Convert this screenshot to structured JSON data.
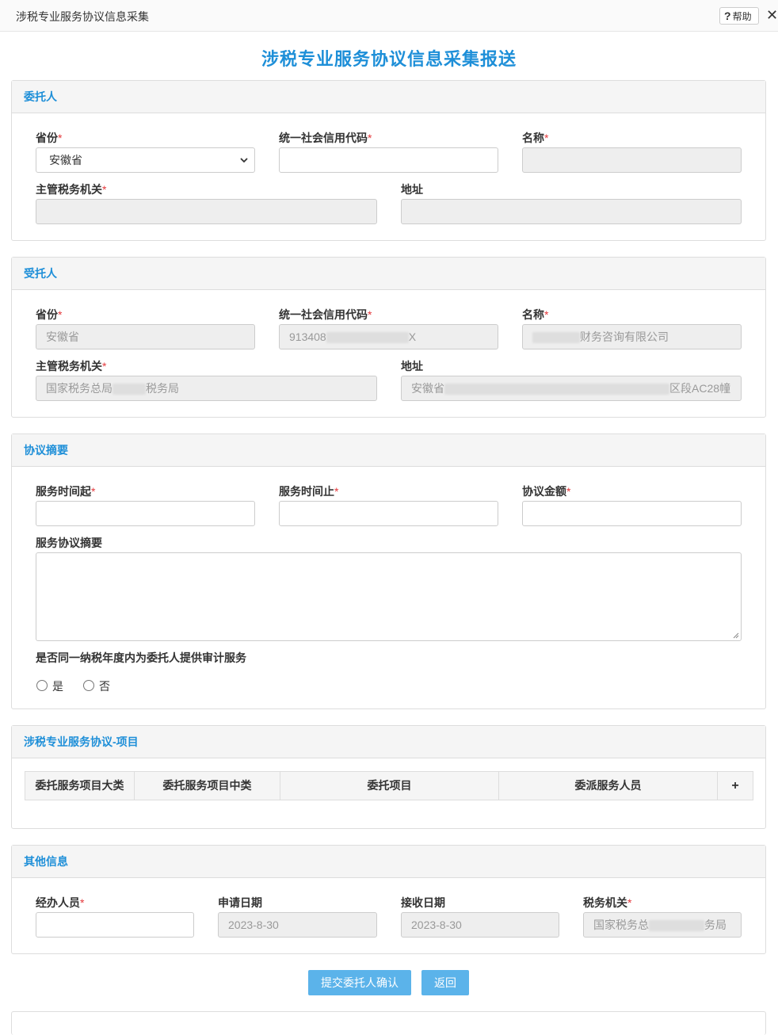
{
  "window": {
    "title": "涉税专业服务协议信息采集",
    "help_label": "帮助",
    "help_glyph": "?",
    "close_glyph": "✕"
  },
  "page": {
    "title": "涉税专业服务协议信息采集报送"
  },
  "colors": {
    "accent": "#1e8fd8",
    "button": "#5bb3ea",
    "required": "#e4393c"
  },
  "required_mark": "*",
  "principal": {
    "heading": "委托人",
    "province_label": "省份",
    "province_value": "安徽省",
    "credit_code_label": "统一社会信用代码",
    "credit_code_value": "",
    "name_label": "名称",
    "name_value": "",
    "tax_authority_label": "主管税务机关",
    "tax_authority_value": "",
    "address_label": "地址",
    "address_value": ""
  },
  "agent": {
    "heading": "受托人",
    "province_label": "省份",
    "province_value": "安徽省",
    "credit_code_label": "统一社会信用代码",
    "credit_code_prefix": "913408",
    "credit_code_suffix": "X",
    "name_label": "名称",
    "name_suffix": "财务咨询有限公司",
    "tax_authority_label": "主管税务机关",
    "tax_authority_prefix": "国家税务总局",
    "tax_authority_suffix": "税务局",
    "address_label": "地址",
    "address_prefix": "安徽省",
    "address_suffix": "区段AC28幢"
  },
  "summary": {
    "heading": "协议摘要",
    "start_label": "服务时间起",
    "end_label": "服务时间止",
    "amount_label": "协议金额",
    "desc_label": "服务协议摘要",
    "audit_question": "是否同一纳税年度内为委托人提供审计服务",
    "yes_label": "是",
    "no_label": "否"
  },
  "items": {
    "heading": "涉税专业服务协议-项目",
    "columns": [
      "委托服务项目大类",
      "委托服务项目中类",
      "委托项目",
      "委派服务人员"
    ],
    "add_glyph": "+"
  },
  "other": {
    "heading": "其他信息",
    "handler_label": "经办人员",
    "apply_date_label": "申请日期",
    "apply_date_value": "2023-8-30",
    "receive_date_label": "接收日期",
    "receive_date_value": "2023-8-30",
    "tax_office_label": "税务机关",
    "tax_office_prefix": "国家税务总",
    "tax_office_suffix": "务局"
  },
  "actions": {
    "submit_label": "提交委托人确认",
    "back_label": "返回"
  }
}
